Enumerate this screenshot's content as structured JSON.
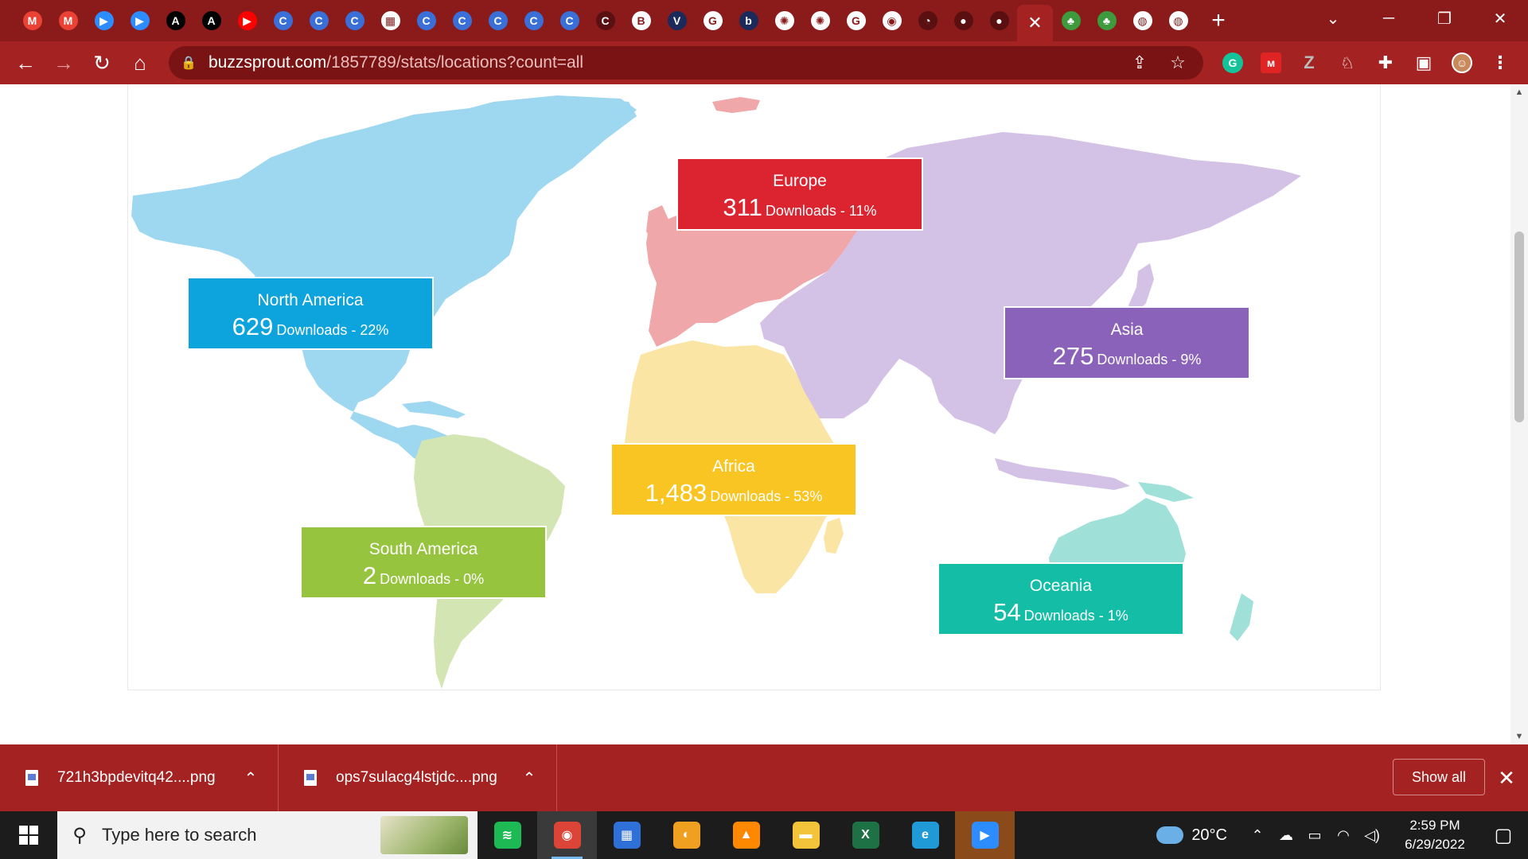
{
  "browser": {
    "tabs": [
      {
        "icon": "gmail-icon",
        "glyph": "M",
        "color": "#ea4335"
      },
      {
        "icon": "gmail-icon",
        "glyph": "M",
        "color": "#ea4335"
      },
      {
        "icon": "zoom-icon",
        "glyph": "▶",
        "color": "#2d8cff"
      },
      {
        "icon": "zoom-icon",
        "glyph": "▶",
        "color": "#2d8cff"
      },
      {
        "icon": "font-a-icon",
        "glyph": "A",
        "color": "#000000"
      },
      {
        "icon": "font-a-icon",
        "glyph": "A",
        "color": "#000000"
      },
      {
        "icon": "youtube-icon",
        "glyph": "▶",
        "color": "#ff0000"
      },
      {
        "icon": "c-circle-icon",
        "glyph": "C",
        "color": "#3a6fd8"
      },
      {
        "icon": "c-circle-icon",
        "glyph": "C",
        "color": "#3a6fd8"
      },
      {
        "icon": "c-circle-icon",
        "glyph": "C",
        "color": "#3a6fd8"
      },
      {
        "icon": "apa-icon",
        "glyph": "▦",
        "color": "#ffffff"
      },
      {
        "icon": "c-circle-icon",
        "glyph": "C",
        "color": "#3a6fd8"
      },
      {
        "icon": "c-circle-icon",
        "glyph": "C",
        "color": "#3a6fd8"
      },
      {
        "icon": "c-circle-icon",
        "glyph": "C",
        "color": "#3a6fd8"
      },
      {
        "icon": "c-circle-icon",
        "glyph": "C",
        "color": "#3a6fd8"
      },
      {
        "icon": "c-circle-icon",
        "glyph": "C",
        "color": "#3a6fd8"
      },
      {
        "icon": "c-dark-icon",
        "glyph": "C",
        "color": "#5a1010"
      },
      {
        "icon": "bud-icon",
        "glyph": "B",
        "color": "#ffffff"
      },
      {
        "icon": "v-icon",
        "glyph": "V",
        "color": "#1b2a5a"
      },
      {
        "icon": "google-icon",
        "glyph": "G",
        "color": "#ffffff"
      },
      {
        "icon": "bw-icon",
        "glyph": "b",
        "color": "#1b2a5a"
      },
      {
        "icon": "brain-icon",
        "glyph": "✺",
        "color": "#ffffff"
      },
      {
        "icon": "brain-icon",
        "glyph": "✺",
        "color": "#ffffff"
      },
      {
        "icon": "google-icon",
        "glyph": "G",
        "color": "#ffffff"
      },
      {
        "icon": "chrome-icon",
        "glyph": "◉",
        "color": "#ffffff"
      },
      {
        "icon": "gauge-icon",
        "glyph": "◔",
        "color": "#5a1010"
      },
      {
        "icon": "github-icon",
        "glyph": "●",
        "color": "#5a1010"
      },
      {
        "icon": "github-icon",
        "glyph": "●",
        "color": "#5a1010"
      },
      {
        "icon": "close-icon",
        "glyph": "✕",
        "color": "#ffffff",
        "active": true
      },
      {
        "icon": "plant-icon",
        "glyph": "♣",
        "color": "#3d9a3d"
      },
      {
        "icon": "plant-icon",
        "glyph": "♣",
        "color": "#3d9a3d"
      },
      {
        "icon": "globe-icon",
        "glyph": "◍",
        "color": "#ffffff"
      },
      {
        "icon": "globe-icon",
        "glyph": "◍",
        "color": "#ffffff"
      }
    ],
    "new_tab": "+",
    "url_host": "buzzsprout.com",
    "url_path": "/1857789/stats/locations?count=all"
  },
  "map": {
    "colors": {
      "north_america": "#9ed7f0",
      "south_america": "#d3e5b2",
      "europe": "#f0a7aa",
      "africa": "#fbe5a4",
      "asia": "#d3c2e6",
      "oceania": "#9fe1d8"
    },
    "regions": [
      {
        "key": "europe",
        "name": "Europe",
        "count": "311",
        "label": "Downloads - 11%",
        "color": "#dc2430"
      },
      {
        "key": "north_america",
        "name": "North America",
        "count": "629",
        "label": "Downloads - 22%",
        "color": "#0da3dd"
      },
      {
        "key": "asia",
        "name": "Asia",
        "count": "275",
        "label": "Downloads - 9%",
        "color": "#8b62b9"
      },
      {
        "key": "africa",
        "name": "Africa",
        "count": "1,483",
        "label": "Downloads - 53%",
        "color": "#f9c523"
      },
      {
        "key": "south_america",
        "name": "South America",
        "count": "2",
        "label": "Downloads - 0%",
        "color": "#96c43f"
      },
      {
        "key": "oceania",
        "name": "Oceania",
        "count": "54",
        "label": "Downloads - 1%",
        "color": "#14bda5"
      }
    ]
  },
  "downloads": {
    "items": [
      {
        "name": "721h3bpdevitq42....png"
      },
      {
        "name": "ops7sulacg4lstjdc....png"
      }
    ],
    "show_all": "Show all"
  },
  "taskbar": {
    "search_placeholder": "Type here to search",
    "apps": [
      {
        "icon": "spotify-icon",
        "glyph": "≋",
        "color": "#1db954"
      },
      {
        "icon": "chrome-icon",
        "glyph": "◉",
        "color": "#db4437",
        "active": true
      },
      {
        "icon": "calendar-icon",
        "glyph": "▦",
        "color": "#2f6fd8"
      },
      {
        "icon": "browser-icon",
        "glyph": "◐",
        "color": "#f0a020"
      },
      {
        "icon": "vlc-icon",
        "glyph": "▲",
        "color": "#ff8800"
      },
      {
        "icon": "file-explorer-icon",
        "glyph": "▬",
        "color": "#f3c33a"
      },
      {
        "icon": "excel-icon",
        "glyph": "X",
        "color": "#1e7145"
      },
      {
        "icon": "edge-icon",
        "glyph": "e",
        "color": "#1f9ad6"
      },
      {
        "icon": "zoom-icon",
        "glyph": "▶",
        "color": "#2d8cff",
        "zoom": true
      }
    ],
    "weather": "20°C",
    "time": "2:59 PM",
    "date": "6/29/2022"
  }
}
